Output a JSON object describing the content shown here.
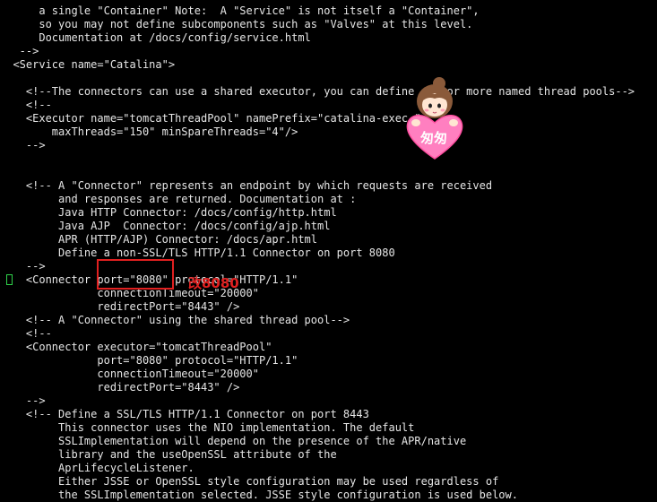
{
  "terminal": {
    "lines": [
      "      a single \"Container\" Note:  A \"Service\" is not itself a \"Container\",",
      "      so you may not define subcomponents such as \"Valves\" at this level.",
      "      Documentation at /docs/config/service.html",
      "   -->",
      "  <Service name=\"Catalina\">",
      "",
      "    <!--The connectors can use a shared executor, you can define one or more named thread pools-->",
      "    <!--",
      "    <Executor name=\"tomcatThreadPool\" namePrefix=\"catalina-exec-\"",
      "        maxThreads=\"150\" minSpareThreads=\"4\"/>",
      "    -->",
      "",
      "",
      "    <!-- A \"Connector\" represents an endpoint by which requests are received",
      "         and responses are returned. Documentation at :",
      "         Java HTTP Connector: /docs/config/http.html",
      "         Java AJP  Connector: /docs/config/ajp.html",
      "         APR (HTTP/AJP) Connector: /docs/apr.html",
      "         Define a non-SSL/TLS HTTP/1.1 Connector on port 8080",
      "    -->",
      "    <Connector port=\"8080\" protocol=\"HTTP/1.1\"",
      "               connectionTimeout=\"20000\"",
      "               redirectPort=\"8443\" />",
      "    <!-- A \"Connector\" using the shared thread pool-->",
      "    <!--",
      "    <Connector executor=\"tomcatThreadPool\"",
      "               port=\"8080\" protocol=\"HTTP/1.1\"",
      "               connectionTimeout=\"20000\"",
      "               redirectPort=\"8443\" />",
      "    -->",
      "    <!-- Define a SSL/TLS HTTP/1.1 Connector on port 8443",
      "         This connector uses the NIO implementation. The default",
      "         SSLImplementation will depend on the presence of the APR/native",
      "         library and the useOpenSSL attribute of the",
      "         AprLifecycleListener.",
      "         Either JSSE or OpenSSL style configuration may be used regardless of",
      "         the SSLImplementation selected. JSSE style configuration is used below."
    ]
  },
  "annotation": {
    "text": "改8080"
  },
  "sticker": {
    "text": "匆匆"
  },
  "colors": {
    "background": "#000000",
    "text": "#e6e6e6",
    "cursor": "#2fd24a",
    "highlight": "#e02020",
    "sticker_heart": "#ff7fc0"
  }
}
